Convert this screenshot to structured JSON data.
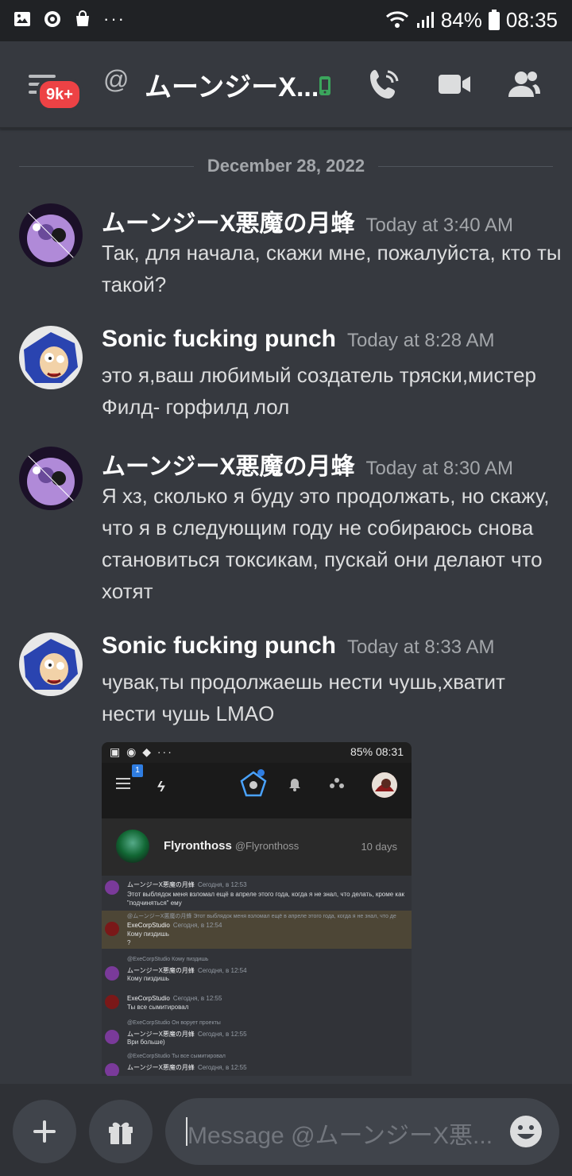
{
  "status_bar": {
    "battery": "84%",
    "time": "08:35",
    "icons": [
      "gallery-icon",
      "app-icon",
      "shopping-bag-icon",
      "more-dots-icon",
      "wifi-icon",
      "signal-icon",
      "battery-icon"
    ]
  },
  "header": {
    "badge": "9k+",
    "at_symbol": "@",
    "title": "ムーンジーX...",
    "actions": [
      "call-icon",
      "video-icon",
      "members-icon"
    ]
  },
  "date_divider": "December 28, 2022",
  "messages": [
    {
      "author": "ムーンジーX悪魔の月蜂",
      "timestamp": "Today at 3:40 AM",
      "text": "Так, для начала, скажи мне, пожалуйста, кто ты такой?"
    },
    {
      "author": "Sonic fucking punch",
      "timestamp": "Today at 8:28 AM",
      "text": "это я,ваш любимый создатель тряски,мистер Филд- горфилд лол"
    },
    {
      "author": "ムーンジーX悪魔の月蜂",
      "timestamp": "Today at 8:30 AM",
      "text": "Я хз, сколько я буду это продолжать, но скажу, что я в следующим году не собираюсь снова становиться токсикам, пускай они делают что хотят"
    },
    {
      "author": "Sonic fucking punch",
      "timestamp": "Today at 8:33 AM",
      "text": "чувак,ты продолжаешь нести чушь,хватит нести чушь LMAO"
    }
  ],
  "attachment": {
    "status_battery": "85%",
    "status_time": "08:31",
    "badge": "1",
    "profile_name": "Flyronthoss",
    "profile_handle": "@Flyronthoss",
    "profile_age": "10 days",
    "chat": [
      {
        "author": "ムーンジーX悪魔の月蜂",
        "time": "Сегодня, в 12:53",
        "text": "Этот выблядок меня взломал ещё в апреле этого года, когда я не знал, что делать, кроме как \"подчиняться\" ему"
      },
      {
        "reply": "@ムーンジーX悪魔の月蜂 Этот выблядок меня взломал ещё в апреле этого года, когда я не знал, что де",
        "author": "ExeCorpStudio",
        "time": "Сегодня, в 12:54",
        "text": "Кому пиздишь",
        "text2": "?"
      },
      {
        "reply": "@ExeCorpStudio Кому пиздишь",
        "author": "ムーンジーX悪魔の月蜂",
        "time": "Сегодня, в 12:54",
        "text": "Кому пиздишь"
      },
      {
        "author": "ExeCorpStudio",
        "time": "Сегодня, в 12:55",
        "text": "Ты все сымитировал"
      },
      {
        "reply": "@ExeCorpStudio Он ворует проекты",
        "author": "ムーンジーX悪魔の月蜂",
        "time": "Сегодня, в 12:55",
        "text": "Ври больше)"
      },
      {
        "reply": "@ExeCorpStudio Ты все сымитировал",
        "author": "ムーンジーX悪魔の月蜂",
        "time": "Сегодня, в 12:55",
        "text": ""
      }
    ]
  },
  "composer": {
    "placeholder": "Message @ムーンジーX悪...",
    "buttons": [
      "add-icon",
      "gift-icon",
      "emoji-icon"
    ]
  },
  "colors": {
    "background": "#36393f",
    "status_bar": "#202225",
    "badge_red": "#ed4245",
    "online_green": "#3ba55c"
  }
}
